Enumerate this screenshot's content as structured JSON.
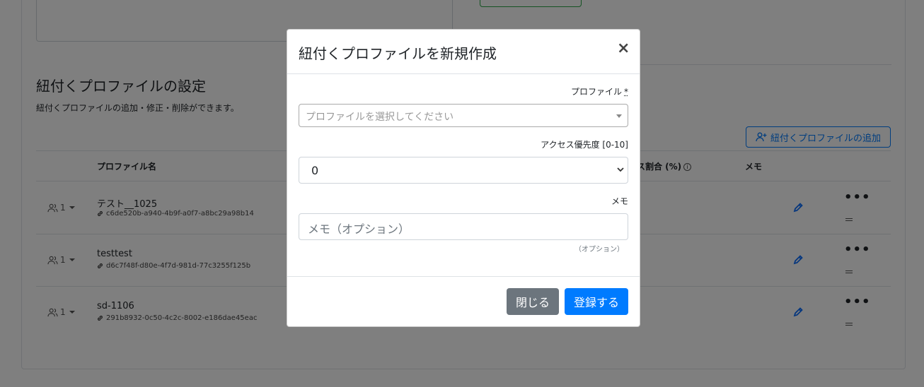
{
  "section": {
    "title": "紐付くプロファイルの設定",
    "description": "紐付くプロファイルの追加・修正・削除ができます。",
    "add_button": "紐付くプロファイルの追加"
  },
  "table": {
    "headers": {
      "profile_name": "プロファイル名",
      "access_ratio": "ス割合 (%)",
      "memo": "メモ"
    },
    "rows": [
      {
        "users": "1",
        "name": "テスト__1025",
        "id": "c6de520b-a940-4b9f-a0f7-a8bc29a98b14"
      },
      {
        "users": "1",
        "name": "testtest",
        "id": "d6c7f48f-d80e-4f7d-981d-77c3255f125b"
      },
      {
        "users": "1",
        "name": "sd-1106",
        "id": "291b8932-0c50-4c2c-8002-e186dae45eac"
      }
    ]
  },
  "modal": {
    "title": "紐付くプロファイルを新規作成",
    "close_glyph": "×",
    "profile_label": "プロファイル",
    "required_mark": "*",
    "profile_placeholder": "プロファイルを選択してください",
    "priority_label": "アクセス優先度 [0-10]",
    "priority_value": "0",
    "memo_label": "メモ",
    "memo_placeholder": "メモ（オプション）",
    "memo_help": "（オプション）",
    "close_button": "閉じる",
    "submit_button": "登録する"
  },
  "colors": {
    "primary": "#007bff",
    "secondary": "#6c757d",
    "backdrop": "rgba(0,0,0,0.5)"
  }
}
